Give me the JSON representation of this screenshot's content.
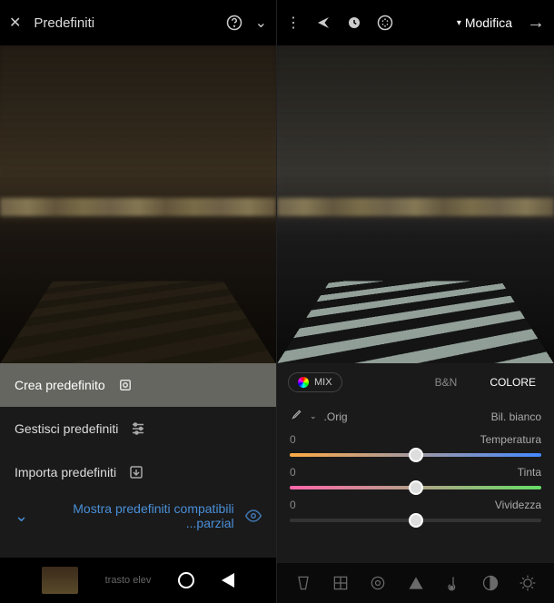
{
  "left": {
    "header": {
      "title": "Predefiniti"
    },
    "menu": {
      "create": "Crea predefinito",
      "manage": "Gestisci predefiniti",
      "import": "Importa predefiniti",
      "show_partial": "Mostra predefiniti compatibili parzial..."
    },
    "bottom": {
      "text": "trasto elev"
    }
  },
  "right": {
    "header": {
      "mode": "Modifica"
    },
    "tabs": {
      "colore": "COLORE",
      "bn": "B&N",
      "mix": "MIX"
    },
    "controls": {
      "wb_label": "Bil. bianco",
      "wb_value": "Orig.",
      "temp_label": "Temperatura",
      "temp_value": "0",
      "tint_label": "Tinta",
      "tint_value": "0",
      "vividness_label": "Vividezza",
      "vividness_value": "0"
    }
  },
  "chart_data": {
    "type": "sliders",
    "sliders": [
      {
        "name": "Temperatura",
        "value": 0,
        "range": [
          -100,
          100
        ]
      },
      {
        "name": "Tinta",
        "value": 0,
        "range": [
          -100,
          100
        ]
      },
      {
        "name": "Vividezza",
        "value": 0,
        "range": [
          -100,
          100
        ]
      }
    ]
  }
}
